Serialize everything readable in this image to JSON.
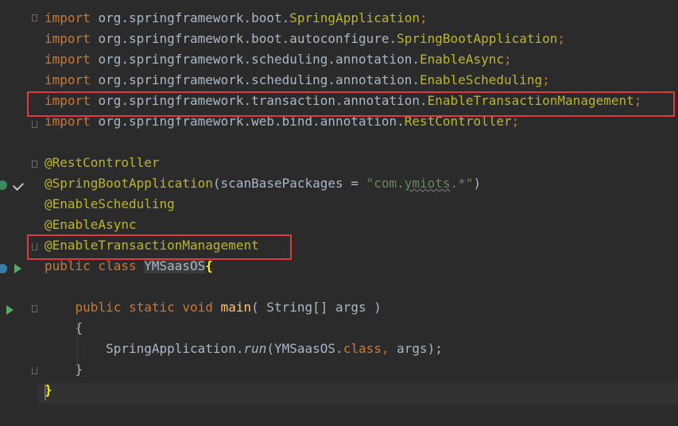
{
  "editor": {
    "lines": [
      {
        "id": "l1",
        "parts": [
          [
            "kw",
            "import "
          ],
          [
            "pkg",
            "org.springframework.boot."
          ],
          [
            "cls",
            "SpringApplication"
          ],
          [
            "kw",
            ";"
          ]
        ]
      },
      {
        "id": "l2",
        "parts": [
          [
            "kw",
            "import "
          ],
          [
            "pkg",
            "org.springframework.boot.autoconfigure."
          ],
          [
            "cls",
            "SpringBootApplication"
          ],
          [
            "kw",
            ";"
          ]
        ]
      },
      {
        "id": "l3",
        "parts": [
          [
            "kw",
            "import "
          ],
          [
            "pkg",
            "org.springframework.scheduling.annotation."
          ],
          [
            "cls",
            "EnableAsync"
          ],
          [
            "kw",
            ";"
          ]
        ]
      },
      {
        "id": "l4",
        "parts": [
          [
            "kw",
            "import "
          ],
          [
            "pkg",
            "org.springframework.scheduling.annotation."
          ],
          [
            "cls",
            "EnableScheduling"
          ],
          [
            "kw",
            ";"
          ]
        ]
      },
      {
        "id": "l5",
        "parts": [
          [
            "kw",
            "import "
          ],
          [
            "pkg",
            "org.springframework.transaction.annotation."
          ],
          [
            "cls",
            "EnableTransactionManagement"
          ],
          [
            "kw",
            ";"
          ]
        ]
      },
      {
        "id": "l6",
        "parts": [
          [
            "kw",
            "import "
          ],
          [
            "pkg",
            "org.springframework.web.bind.annotation."
          ],
          [
            "cls",
            "RestController"
          ],
          [
            "kw",
            ";"
          ]
        ]
      },
      {
        "id": "l7",
        "parts": []
      },
      {
        "id": "l8",
        "parts": [
          [
            "ann",
            "@RestController"
          ]
        ]
      },
      {
        "id": "l9",
        "parts": [
          [
            "ann",
            "@SpringBootApplication"
          ],
          [
            "pkg",
            "(scanBasePackages = "
          ],
          [
            "str",
            "\"com."
          ],
          [
            "str squig",
            "ymiots"
          ],
          [
            "str",
            ".*\""
          ],
          [
            "pkg",
            ")"
          ]
        ]
      },
      {
        "id": "l10",
        "parts": [
          [
            "ann",
            "@EnableScheduling"
          ]
        ]
      },
      {
        "id": "l11",
        "parts": [
          [
            "ann",
            "@EnableAsync"
          ]
        ]
      },
      {
        "id": "l12",
        "parts": [
          [
            "ann",
            "@EnableTransactionManagement"
          ]
        ]
      },
      {
        "id": "l13",
        "parts": [
          [
            "kw",
            "public class "
          ],
          [
            "hl-cls",
            "YMSaasOS"
          ],
          [
            "brace-hl",
            "{"
          ]
        ]
      },
      {
        "id": "l14",
        "parts": []
      },
      {
        "id": "l15",
        "parts": [
          [
            "pkg",
            "    "
          ],
          [
            "kw",
            "public static void "
          ],
          [
            "fn",
            "main"
          ],
          [
            "pkg",
            "( String[] args )"
          ]
        ]
      },
      {
        "id": "l16",
        "parts": [
          [
            "pkg",
            "    {"
          ]
        ]
      },
      {
        "id": "l17",
        "parts": [
          [
            "pkg",
            "        SpringApplication."
          ],
          [
            "ital",
            "run"
          ],
          [
            "pkg",
            "(YMSaasOS."
          ],
          [
            "kw",
            "class"
          ],
          [
            "kw",
            ", "
          ],
          [
            "pkg",
            "args);"
          ]
        ]
      },
      {
        "id": "l18",
        "parts": [
          [
            "pkg",
            "    }"
          ]
        ]
      },
      {
        "id": "l19",
        "parts": [
          [
            "brace-hl",
            "}"
          ]
        ]
      }
    ]
  }
}
